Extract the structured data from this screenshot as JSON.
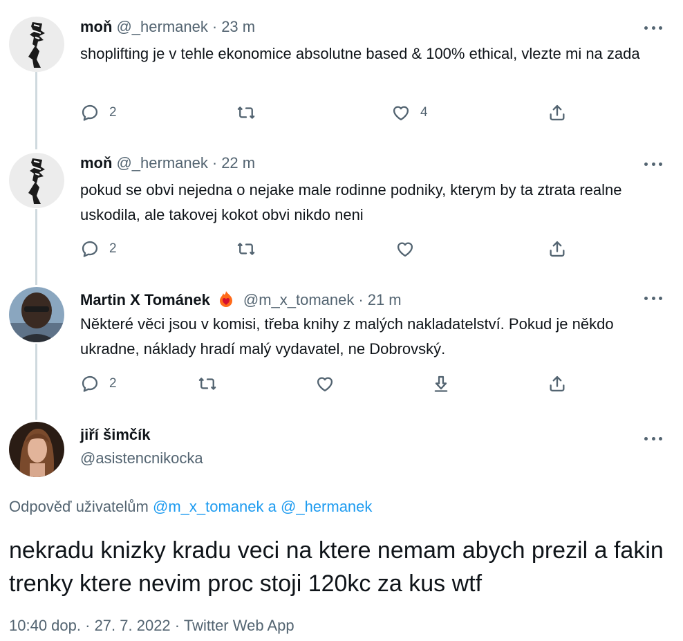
{
  "tweets": [
    {
      "name": "moň",
      "handle": "@_hermanek",
      "dot": "·",
      "time": "23 m",
      "text": "shoplifting je v tehle ekonomice absolutne based & 100% ethical, vlezte mi na zada",
      "reply_count": "2",
      "retweet_count": "",
      "like_count": "4"
    },
    {
      "name": "moň",
      "handle": "@_hermanek",
      "dot": "·",
      "time": "22 m",
      "text": "pokud se obvi nejedna o nejake male rodinne podniky, kterym by ta ztrata realne uskodila, ale takovej kokot obvi nikdo neni",
      "reply_count": "2",
      "retweet_count": "",
      "like_count": ""
    },
    {
      "name": "Martin X Tománek",
      "handle": "@m_x_tomanek",
      "dot": "·",
      "time": "21 m",
      "text": "Některé věci jsou v komisi, třeba knihy z malých nakladatelství. Pokud je někdo ukradne, náklady hradí malý vydavatel, ne Dobrovský.",
      "reply_count": "2",
      "retweet_count": "",
      "like_count": ""
    }
  ],
  "main": {
    "name": "jiří šimčík",
    "handle": "@asistencnikocka",
    "reply_prefix": "Odpověď uživatelům",
    "mention_1": "@m_x_tomanek",
    "conjunction": "a",
    "mention_2": "@_hermanek",
    "text": "nekradu knizky kradu veci na ktere nemam abych prezil a fakin trenky ktere nevim proc stoji 120kc za kus wtf",
    "time": "10:40 dop.",
    "dot": "·",
    "date": "27. 7. 2022",
    "source": "Twitter Web App"
  },
  "icons": {
    "reply": "reply-icon",
    "retweet": "retweet-icon",
    "like": "heart-icon",
    "share": "share-icon",
    "download": "download-icon",
    "more": "more-icon",
    "verified": "flame-heart-badge-icon"
  },
  "colors": {
    "text": "#0f1419",
    "secondary": "#536471",
    "link": "#1d9bf0",
    "thread_line": "#cfd9de"
  }
}
